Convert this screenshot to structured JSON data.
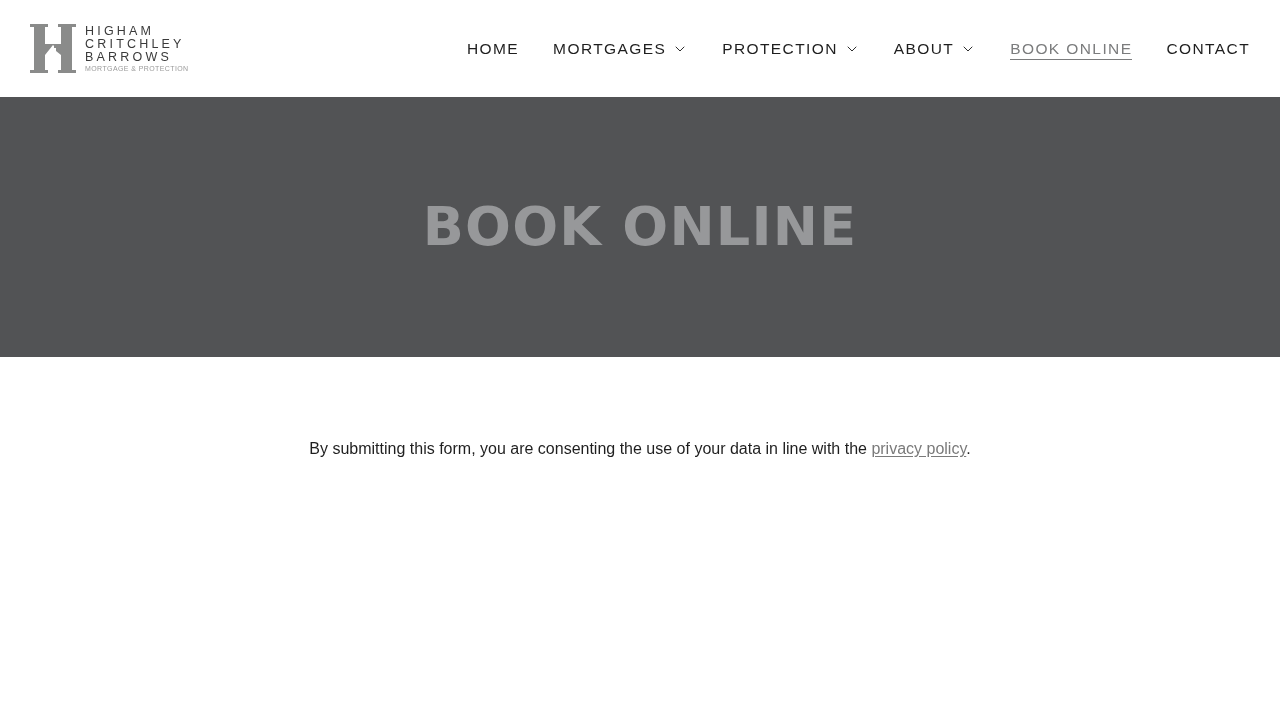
{
  "header": {
    "logo": {
      "lines": [
        "HIGHAM",
        "CRITCHLEY",
        "BARROWS"
      ],
      "tagline": "MORTGAGE & PROTECTION"
    },
    "nav": [
      {
        "label": "HOME",
        "has_dropdown": false,
        "selected": false
      },
      {
        "label": "MORTGAGES",
        "has_dropdown": true,
        "selected": false
      },
      {
        "label": "PROTECTION",
        "has_dropdown": true,
        "selected": false
      },
      {
        "label": "ABOUT",
        "has_dropdown": true,
        "selected": false
      },
      {
        "label": "BOOK ONLINE",
        "has_dropdown": false,
        "selected": true
      },
      {
        "label": "CONTACT",
        "has_dropdown": false,
        "selected": false
      }
    ]
  },
  "hero": {
    "title": "BOOK ONLINE"
  },
  "consent": {
    "text": "By submitting this form, you are consenting the use of your data in line with the",
    "link": "privacy policy",
    "after": "."
  }
}
